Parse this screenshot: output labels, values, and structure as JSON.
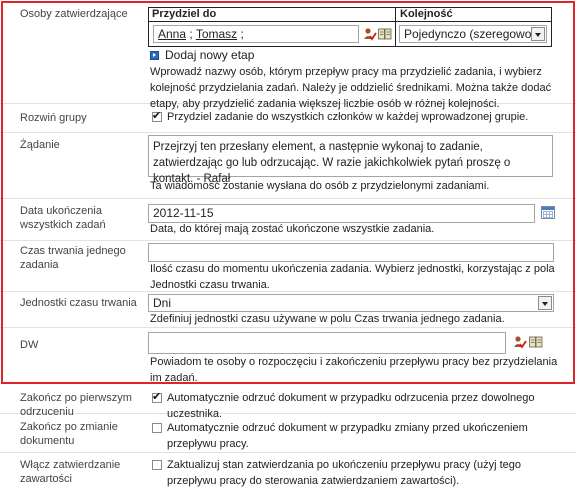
{
  "rows": {
    "assignees": {
      "label": "Osoby zatwierdzające",
      "col_assign_to": "Przydziel do",
      "col_order": "Kolejność",
      "people": [
        "Anna",
        "Tomasz"
      ],
      "people_sep": " ; ",
      "people_trail": " ;",
      "order_value": "Pojedynczo (szeregowo)",
      "add_stage": "Dodaj nowy etap",
      "help": "Wprowadź nazwy osób, którym przepływ pracy ma przydzielić zadania, i wybierz kolejność przydzielania zadań. Należy je oddzielić średnikami. Można także dodać etapy, aby przydzielić zadania większej liczbie osób w różnej kolejności."
    },
    "expand_groups": {
      "label": "Rozwiń grupy",
      "checked": true,
      "checkbox_label": "Przydziel zadanie do wszystkich członków w każdej wprowadzonej grupie."
    },
    "request": {
      "label": "Żądanie",
      "value": "Przejrzyj ten przesłany element, a następnie wykonaj to zadanie, zatwierdzając go lub odrzucając. W razie jakichkolwiek pytań proszę o kontakt. - Rafał",
      "help": "Ta wiadomość zostanie wysłana do osób z przydzielonymi zadaniami."
    },
    "due_date": {
      "label": "Data ukończenia wszystkich zadań",
      "value": "2012-11-15",
      "help": "Data, do której mają zostać ukończone wszystkie zadania."
    },
    "duration": {
      "label": "Czas trwania jednego zadania",
      "value": "",
      "help": "Ilość czasu do momentu ukończenia zadania. Wybierz jednostki, korzystając z pola Jednostki czasu trwania."
    },
    "duration_units": {
      "label": "Jednostki czasu trwania",
      "value": "Dni",
      "help": "Zdefiniuj jednostki czasu używane w polu Czas trwania jednego zadania."
    },
    "cc": {
      "label": "DW",
      "value": "",
      "help": "Powiadom te osoby o rozpoczęciu i zakończeniu przepływu pracy bez przydzielania im zadań."
    },
    "end_on_first_reject": {
      "label": "Zakończ po pierwszym odrzuceniu",
      "checked": true,
      "checkbox_label": "Automatycznie odrzuć dokument w przypadku odrzucenia przez dowolnego uczestnika."
    },
    "end_on_change": {
      "label": "Zakończ po zmianie dokumentu",
      "checked": false,
      "checkbox_label": "Automatycznie odrzuć dokument w przypadku zmiany przed ukończeniem przepływu pracy."
    },
    "content_approval": {
      "label": "Włącz zatwierdzanie zawartości",
      "checked": false,
      "checkbox_label": "Zaktualizuj stan zatwierdzania po ukończeniu przepływu pracy (użyj tego przepływu pracy do sterowania zatwierdzaniem zawartości)."
    }
  },
  "icons": {
    "check_names": "check-names-icon",
    "browse": "address-book-icon",
    "calendar": "calendar-icon",
    "add": "add-stage-icon",
    "dropdown": "chevron-down-icon"
  },
  "colors": {
    "highlight_border": "#e0232b",
    "add_icon": "#2a6ebb"
  }
}
